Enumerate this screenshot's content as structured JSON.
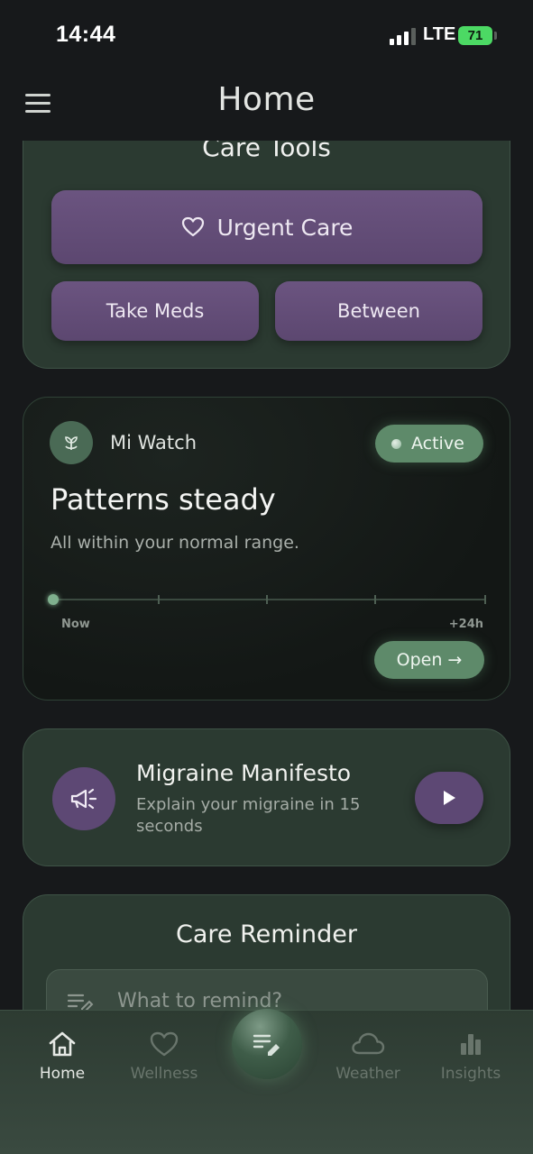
{
  "status_bar": {
    "time": "14:44",
    "network": "LTE",
    "battery": "71"
  },
  "header": {
    "title": "Home"
  },
  "care_tools": {
    "title": "Care Tools",
    "urgent_label": "Urgent Care",
    "take_meds_label": "Take Meds",
    "between_label": "Between"
  },
  "watch": {
    "device_name": "Mi Watch",
    "status": "Active",
    "headline": "Patterns steady",
    "subtitle": "All within your normal range.",
    "timeline_start": "Now",
    "timeline_end": "+24h",
    "open_label": "Open →"
  },
  "migraine": {
    "title": "Migraine Manifesto",
    "subtitle": "Explain your migraine in 15 seconds"
  },
  "reminder": {
    "title": "Care Reminder",
    "placeholder": "What to remind?"
  },
  "tabs": [
    {
      "label": "Home",
      "icon": "home-icon"
    },
    {
      "label": "Wellness",
      "icon": "heart-icon"
    },
    {
      "label": "Weather",
      "icon": "cloud-icon"
    },
    {
      "label": "Insights",
      "icon": "bar-chart-icon"
    }
  ],
  "colors": {
    "background": "#17191b",
    "card": "#2b3a31",
    "purple_button": "#5c4770",
    "green_accent": "#5e8a6a"
  }
}
